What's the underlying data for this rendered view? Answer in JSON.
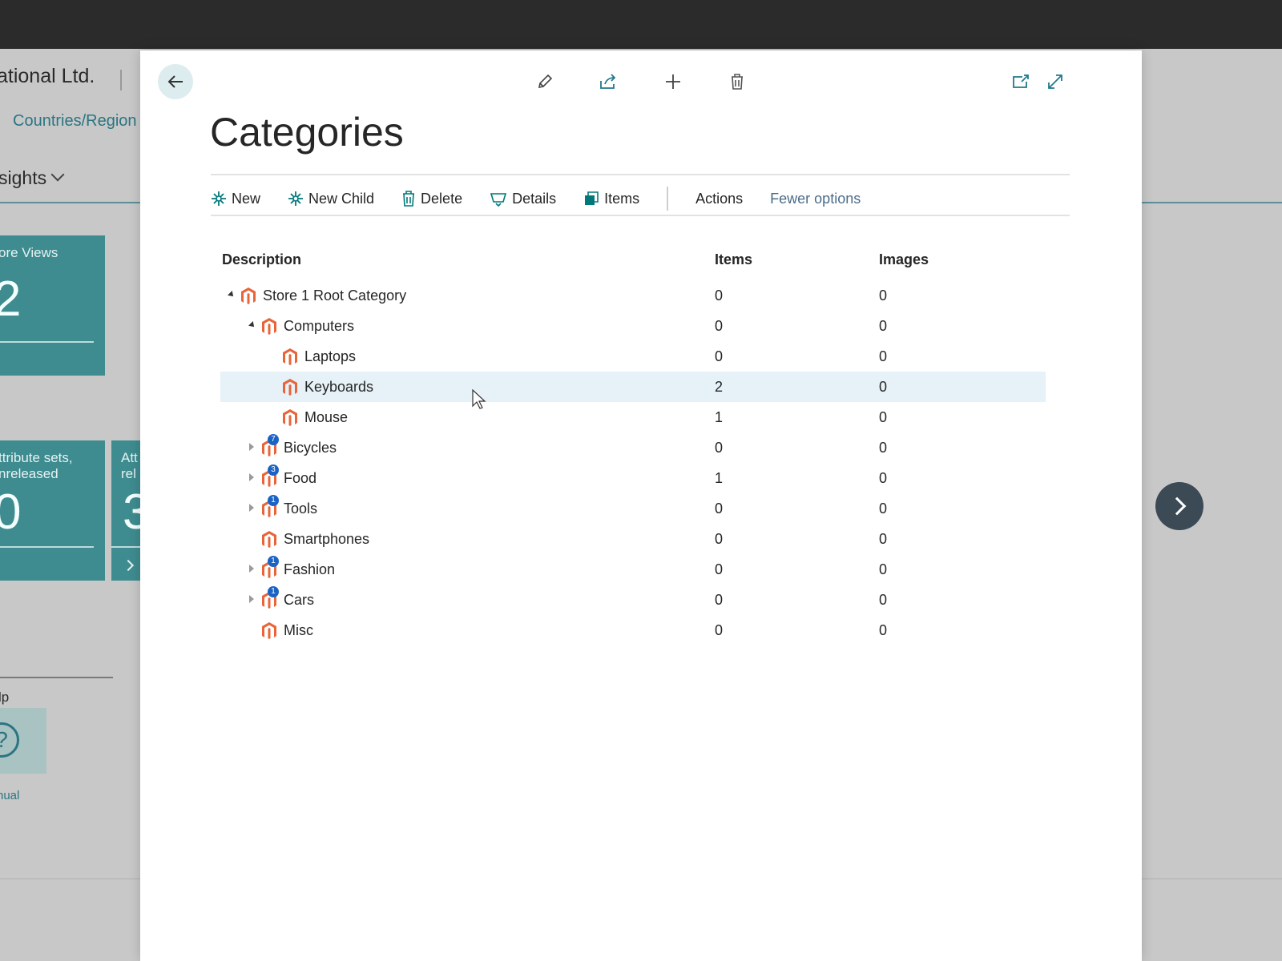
{
  "background_page": {
    "company_name": "ational Ltd.",
    "nav_link": "Countries/Region",
    "insights_label": "sights",
    "tiles": [
      {
        "label": "ore Views",
        "value": "2"
      },
      {
        "label": "ttribute sets,\nnreleased",
        "value": "0"
      },
      {
        "label": "Att\nrel",
        "value": "3"
      }
    ],
    "help_label": "lp",
    "manual_label": "nual"
  },
  "dialog": {
    "title": "Categories",
    "top_icons": [
      "edit-icon",
      "share-icon",
      "plus-icon",
      "delete-icon",
      "open-new-window-icon",
      "expand-icon"
    ],
    "actions": {
      "new": "New",
      "new_child": "New Child",
      "delete": "Delete",
      "details": "Details",
      "items": "Items",
      "actions": "Actions",
      "fewer_options": "Fewer options"
    },
    "accent_color": "#00787a"
  },
  "table": {
    "columns": {
      "description": "Description",
      "items": "Items",
      "images": "Images"
    },
    "rows": [
      {
        "level": 0,
        "expander": "open",
        "description": "Store 1 Root Category",
        "items": "0",
        "images": "0",
        "badge": "",
        "selected": false
      },
      {
        "level": 1,
        "expander": "open",
        "description": "Computers",
        "items": "0",
        "images": "0",
        "badge": "",
        "selected": false
      },
      {
        "level": 2,
        "expander": "none",
        "description": "Laptops",
        "items": "0",
        "images": "0",
        "badge": "",
        "selected": false
      },
      {
        "level": 2,
        "expander": "none",
        "description": "Keyboards",
        "items": "2",
        "images": "0",
        "badge": "",
        "selected": true
      },
      {
        "level": 2,
        "expander": "none",
        "description": "Mouse",
        "items": "1",
        "images": "0",
        "badge": "",
        "selected": false
      },
      {
        "level": 1,
        "expander": "closed",
        "description": "Bicycles",
        "items": "0",
        "images": "0",
        "badge": "7",
        "selected": false
      },
      {
        "level": 1,
        "expander": "closed",
        "description": "Food",
        "items": "1",
        "images": "0",
        "badge": "3",
        "selected": false
      },
      {
        "level": 1,
        "expander": "closed",
        "description": "Tools",
        "items": "0",
        "images": "0",
        "badge": "1",
        "selected": false
      },
      {
        "level": 1,
        "expander": "none",
        "description": "Smartphones",
        "items": "0",
        "images": "0",
        "badge": "",
        "selected": false
      },
      {
        "level": 1,
        "expander": "closed",
        "description": "Fashion",
        "items": "0",
        "images": "0",
        "badge": "1",
        "selected": false
      },
      {
        "level": 1,
        "expander": "closed",
        "description": "Cars",
        "items": "0",
        "images": "0",
        "badge": "1",
        "selected": false
      },
      {
        "level": 1,
        "expander": "none",
        "description": "Misc",
        "items": "0",
        "images": "0",
        "badge": "",
        "selected": false
      }
    ]
  }
}
